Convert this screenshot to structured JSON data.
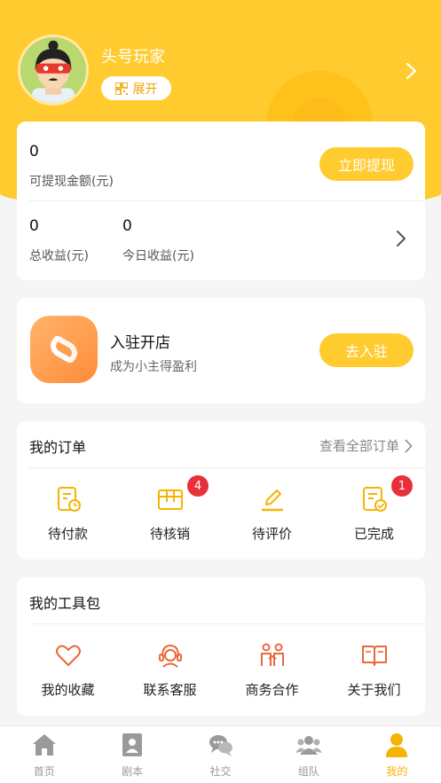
{
  "profile": {
    "username": "头号玩家",
    "expand_label": "展开"
  },
  "earnings": {
    "withdrawable_amount": "0",
    "withdrawable_label": "可提现金额(元)",
    "withdraw_button": "立即提现",
    "total_amount": "0",
    "total_label": "总收益(元)",
    "today_amount": "0",
    "today_label": "今日收益(元)"
  },
  "shop": {
    "title": "入驻开店",
    "subtitle": "成为小主得盈利",
    "button": "去入驻"
  },
  "orders": {
    "title": "我的订单",
    "see_all": "查看全部订单",
    "items": [
      {
        "label": "待付款",
        "icon": "pending-payment-icon"
      },
      {
        "label": "待核销",
        "icon": "pending-verify-icon",
        "badge": "4"
      },
      {
        "label": "待评价",
        "icon": "pending-review-icon"
      },
      {
        "label": "已完成",
        "icon": "completed-icon",
        "badge": "1"
      }
    ]
  },
  "tools": {
    "title": "我的工具包",
    "items": [
      {
        "label": "我的收藏",
        "icon": "heart-icon"
      },
      {
        "label": "联系客服",
        "icon": "customer-service-icon"
      },
      {
        "label": "商务合作",
        "icon": "cooperation-icon"
      },
      {
        "label": "关于我们",
        "icon": "book-icon"
      }
    ]
  },
  "tabbar": {
    "items": [
      {
        "label": "首页",
        "icon": "home-icon"
      },
      {
        "label": "剧本",
        "icon": "script-icon"
      },
      {
        "label": "社交",
        "icon": "chat-icon"
      },
      {
        "label": "组队",
        "icon": "team-icon"
      },
      {
        "label": "我的",
        "icon": "user-icon",
        "active": true
      }
    ]
  },
  "colors": {
    "brand_yellow": "#ffcb2e",
    "accent_orange": "#e8693a",
    "badge_red": "#e8303a",
    "active_tab": "#f5b400"
  }
}
